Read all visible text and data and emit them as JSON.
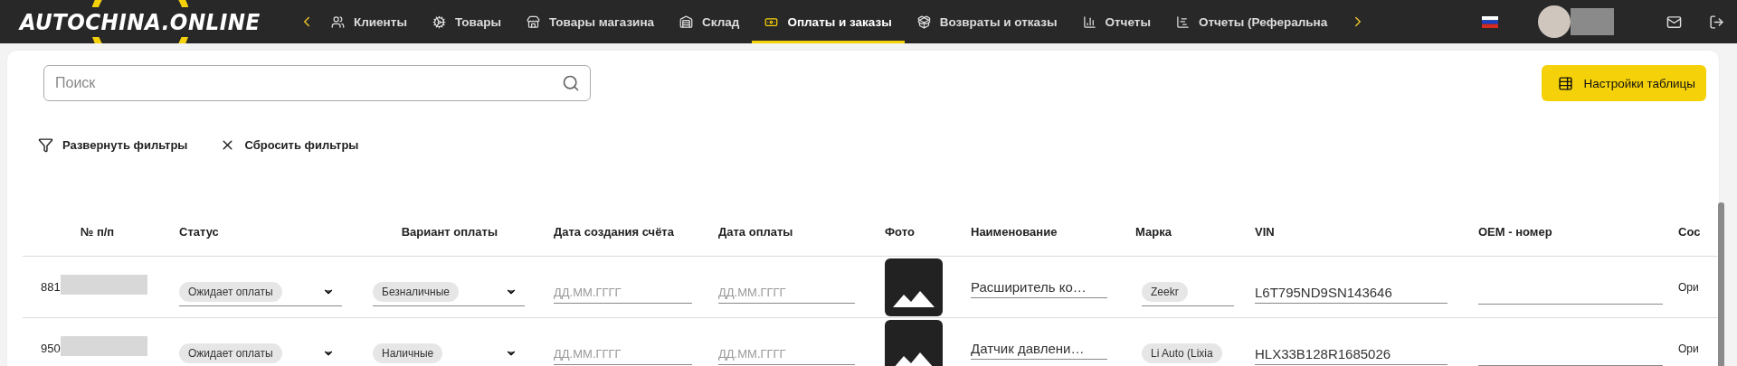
{
  "header": {
    "logo": "AUTOCHINA.ONLINE",
    "nav_items": [
      {
        "label": "Клиенты",
        "selected": false
      },
      {
        "label": "Товары",
        "selected": false
      },
      {
        "label": "Товары магазина",
        "selected": false
      },
      {
        "label": "Склад",
        "selected": false
      },
      {
        "label": "Оплаты и заказы",
        "selected": true
      },
      {
        "label": "Возвраты и отказы",
        "selected": false
      },
      {
        "label": "Отчеты",
        "selected": false
      },
      {
        "label": "Отчеты (Реферальна",
        "selected": false
      }
    ]
  },
  "toolbar": {
    "search": {
      "placeholder": "Поиск"
    },
    "settings_button": "Настройки таблицы",
    "expand_filters": "Развернуть фильтры",
    "reset_filters": "Сбросить фильтры"
  },
  "table": {
    "columns": [
      "№ п/п",
      "Статус",
      "Вариант оплаты",
      "Дата создания счёта",
      "Дата оплаты",
      "Фото",
      "Наименование",
      "Марка",
      "VIN",
      "OEM - номер",
      "Сос"
    ],
    "rows": [
      {
        "number": "881",
        "status": "Ожидает оплаты",
        "payment": "Безналичные",
        "created_date": {
          "placeholder": "ДД.ММ.ГГГГ"
        },
        "paid_date": {
          "placeholder": "ДД.ММ.ГГГГ"
        },
        "name": "Расширитель ко…",
        "brand": "Zeekr",
        "vin": "L6T795ND9SN143646",
        "condition": "Ори"
      },
      {
        "number": "950",
        "status": "Ожидает оплаты",
        "payment": "Наличные",
        "created_date": {
          "placeholder": "ДД.ММ.ГГГГ"
        },
        "paid_date": {
          "placeholder": "ДД.ММ.ГГГГ"
        },
        "name": "Датчик давлени…",
        "brand": "Li Auto (Lixia",
        "vin": "HLX33B128R1685026",
        "condition": "Ори"
      }
    ]
  }
}
